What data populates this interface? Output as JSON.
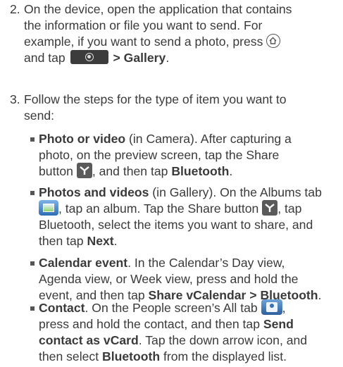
{
  "step2": {
    "number": "2.",
    "line1": "On the device, open the application that contains",
    "line2": "the information or file you want to send. For",
    "line3": "example, if you want to send a photo, press",
    "line4_pre": "and tap",
    "line4_link": "> Gallery",
    "line4_end": "."
  },
  "step3": {
    "number": "3.",
    "line1": "Follow the steps for the type of item you want to",
    "line2": "send:"
  },
  "bullets": [
    {
      "title": "Photo or video",
      "l1": " (in Camera). After capturing a",
      "l2": "photo, on the preview screen, tap the Share",
      "l3a": "button",
      "l3b": ", and then tap",
      "l3c": "Bluetooth",
      "l3d": "."
    },
    {
      "title": "Photos and videos",
      "l1": " (in Gallery). On the Albums tab",
      "l2b": ", tap an album. Tap the Share button",
      "l2c": ", tap",
      "l3": "Bluetooth, select the items you want to share, and",
      "l4a": "then tap",
      "l4b": "Next",
      "l4c": "."
    },
    {
      "title": "Calendar event",
      "l1": ". In the Calendar’s Day view,",
      "l2": "Agenda view, or Week view, press and hold the",
      "l3a": "event, and then tap",
      "l3b": "Share vCalendar > Bluetooth",
      "l3c": "."
    },
    {
      "title": "Contact",
      "l1": ". On the People screen’s All tab",
      "l1b": ",",
      "l2a": "press and hold the contact, and then tap",
      "l2b": "Send",
      "l3a": "contact as vCard",
      "l3b": ". Tap the down arrow icon, and",
      "l4a": "then select",
      "l4b": "Bluetooth",
      "l4c": " from the displayed list."
    }
  ],
  "icons": {
    "home": "home-key-icon",
    "all_apps": "all-apps-key-icon",
    "share": "share-icon",
    "albums": "albums-tab-icon",
    "people_all": "people-all-tab-icon"
  }
}
